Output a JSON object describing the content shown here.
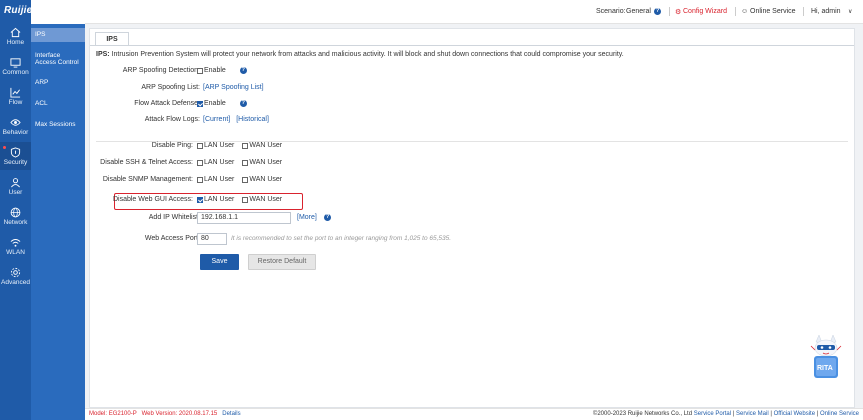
{
  "brand": {
    "logo": "Ruijie",
    "product": "EG"
  },
  "header": {
    "scenario_label": "Scenario:",
    "scenario_value": "General",
    "config_wizard": "Config Wizard",
    "online_service": "Online Service",
    "greeting": "Hi, admin",
    "accent": "#d9232e"
  },
  "nav": [
    {
      "label": "Home",
      "icon": "home-icon"
    },
    {
      "label": "Common",
      "icon": "monitor-icon"
    },
    {
      "label": "Flow",
      "icon": "chart-icon"
    },
    {
      "label": "Behavior",
      "icon": "eye-icon"
    },
    {
      "label": "Security",
      "icon": "shield-icon",
      "active": true
    },
    {
      "label": "User",
      "icon": "user-icon"
    },
    {
      "label": "Network",
      "icon": "globe-icon"
    },
    {
      "label": "WLAN",
      "icon": "wifi-icon"
    },
    {
      "label": "Advanced",
      "icon": "gear-icon"
    }
  ],
  "submenu": [
    {
      "label": "IPS",
      "active": true
    },
    {
      "label": "Interface Access Control"
    },
    {
      "label": "ARP"
    },
    {
      "label": "ACL"
    },
    {
      "label": "Max Sessions"
    }
  ],
  "tab": "IPS",
  "description": {
    "prefix": "IPS:",
    "text": " Intrusion Prevention System will protect your network from attacks and malicious activity. It will block and shut down connections that could compromise your security."
  },
  "form": {
    "arp_spoofing_detection": {
      "label": "ARP Spoofing Detection:",
      "option": "Enable",
      "checked": false
    },
    "arp_spoofing_list": {
      "label": "ARP Spoofing List:",
      "link": "[ARP Spoofing List]"
    },
    "flow_attack_defense": {
      "label": "Flow Attack Defense:",
      "option": "Enable",
      "checked": true
    },
    "attack_flow_logs": {
      "label": "Attack Flow Logs:",
      "current": "[Current]",
      "historical": "[Historical]"
    },
    "disable_ping": {
      "label": "Disable Ping:",
      "lan": "LAN User",
      "wan": "WAN User",
      "lan_checked": false,
      "wan_checked": false
    },
    "disable_ssh": {
      "label": "Disable SSH & Telnet Access:",
      "lan": "LAN User",
      "wan": "WAN User",
      "lan_checked": false,
      "wan_checked": false
    },
    "disable_snmp": {
      "label": "Disable SNMP Management:",
      "lan": "LAN User",
      "wan": "WAN User",
      "lan_checked": false,
      "wan_checked": false
    },
    "disable_web_gui": {
      "label": "Disable Web GUI Access:",
      "lan": "LAN User",
      "wan": "WAN User",
      "lan_checked": true,
      "wan_checked": false
    },
    "ip_whitelist": {
      "label": "Add IP Whitelist:",
      "value": "192.168.1.1",
      "more": "[More]"
    },
    "web_access_port": {
      "label": "Web Access Port:",
      "value": "80",
      "hint": "It is recommended to set the port to an integer ranging from 1,025 to 65,535."
    }
  },
  "buttons": {
    "save": "Save",
    "restore": "Restore Default"
  },
  "mascot": {
    "label": "RITA"
  },
  "footer": {
    "model_label": "Model:",
    "model_value": "EG2100-P",
    "version_label": "Web Version:",
    "version_value": "2020.08.17.15",
    "details": "Details",
    "copyright": "©2000-2023 Ruijie Networks Co., Ltd",
    "service_portal": "Service Portal",
    "service_mail": "Service Mail",
    "official_website": "Official Website",
    "online_service": "Online Service"
  }
}
